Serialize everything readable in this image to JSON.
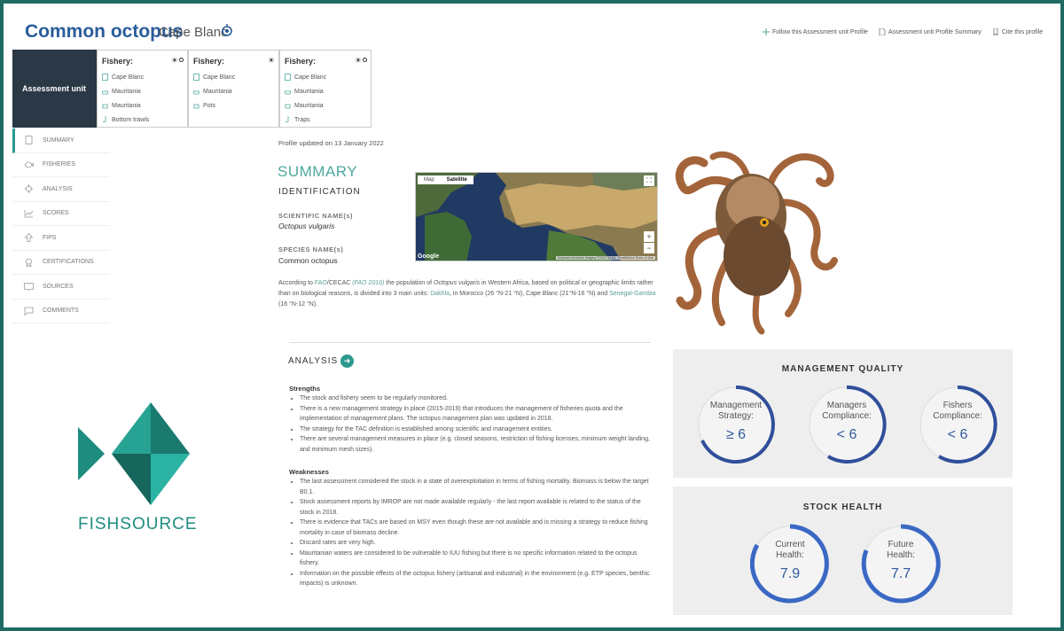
{
  "header": {
    "title": "Common octopus",
    "subtitle": "Cape Blanc",
    "actions": [
      {
        "label": "Follow this Assessment unit Profile",
        "icon": "plus-icon"
      },
      {
        "label": "Assessment unit Profile Summary",
        "icon": "document-icon"
      },
      {
        "label": "Cite this profile",
        "icon": "bookmark-icon"
      }
    ]
  },
  "assessment_unit": {
    "label": "Assessment unit"
  },
  "fisheries": [
    {
      "heading": "Fishery:",
      "items": [
        "Cape Blanc",
        "Mauritania",
        "Mauritania",
        "Bottom trawls"
      ]
    },
    {
      "heading": "Fishery:",
      "items": [
        "Cape Blanc",
        "Mauritania",
        "Pots"
      ]
    },
    {
      "heading": "Fishery:",
      "items": [
        "Cape Blanc",
        "Mauritania",
        "Mauritania",
        "Traps"
      ]
    }
  ],
  "sidenav": [
    "SUMMARY",
    "FISHERIES",
    "ANALYSIS",
    "SCORES",
    "FIPS",
    "CERTIFICATIONS",
    "SOURCES",
    "COMMENTS"
  ],
  "summary": {
    "updated": "Profile updated on 13 January 2022",
    "heading": "SUMMARY",
    "identification": "IDENTIFICATION",
    "sci_label": "SCIENTIFIC NAME(s)",
    "sci_value": "Octopus vulgaris",
    "species_label": "SPECIES NAME(s)",
    "species_value": "Common octopus",
    "intro": {
      "t1": "According to ",
      "l1": "FAO",
      "t2": "/CECAC ",
      "l2": "(FAO 2016)",
      "t3": " the population of ",
      "t4": "Octopus vulgaris",
      "t5": " in Western Africa, based on political or geographic limits rather than on biological reasons, is divided into 3 main units: ",
      "l3": "Dakhla",
      "t6": ", in Morocco (26 °N-21 °N), Cape Blanc (21°N-16 °N) and ",
      "l4": "Senegal-Gambia",
      "t7": " (16 °N-12 °N)."
    }
  },
  "map": {
    "tab_map": "Map",
    "tab_satellite": "Satellite",
    "google": "Google",
    "attribution": "Keyboard shortcuts  Imagery ©2022 NASA, TerraMetrics  Terms of Use",
    "zoom_in": "+",
    "zoom_out": "−"
  },
  "analysis": {
    "heading": "ANALYSIS",
    "strengths_h": "Strengths",
    "strengths": [
      "The stock and fishery seem to be regularly monitored.",
      "There is a new management strategy in place (2015-2019) that introduces the management of fisheries quota and the implementation of management plans. The octopus management plan was updated in 2018.",
      "The strategy for the TAC definition is established among scientific and management entities.",
      "There are several management measures in place (e.g. closed seasons, restriction of fishing licenses, minimum weight landing, and minimum mesh sizes)."
    ],
    "weaknesses_h": "Weaknesses",
    "weaknesses": [
      "The last assessment considered the stock in a state of overexploitation in terms of fishing mortality. Biomass is below the target B0.1.",
      "Stock assessment reports by IMROP are not made available regularly - the last report available is related to the status of the stock in 2018.",
      "There is evidence that TACs are based on MSY even though these are not available and is missing a strategy to reduce fishing mortality in case of biomass decline.",
      "Discard rates are very high.",
      "Mauritanian waters are considered to be vulnerable to IUU fishing but there is no specific information related to the octopus fishery.",
      "Information on the possible effects of the octopus fishery (artisanal and industrial) in the environment (e.g. ETP species, benthic impacts) is unknown."
    ]
  },
  "management_quality": {
    "title": "MANAGEMENT QUALITY",
    "gauges": [
      {
        "l1": "Management",
        "l2": "Strategy:",
        "value": "≥ 6"
      },
      {
        "l1": "Managers",
        "l2": "Compliance:",
        "value": "< 6"
      },
      {
        "l1": "Fishers",
        "l2": "Compliance:",
        "value": "< 6"
      }
    ]
  },
  "stock_health": {
    "title": "STOCK HEALTH",
    "gauges": [
      {
        "l1": "Current",
        "l2": "Health:",
        "value": "7.9"
      },
      {
        "l1": "Future",
        "l2": "Health:",
        "value": "7.7"
      }
    ]
  },
  "logo": {
    "text": "FISHSOURCE"
  },
  "colors": {
    "accent": "#2b9a8d",
    "title_blue": "#2a5d9a",
    "gauge_blue": "#2f5b9e",
    "border": "#1f6b63",
    "dark": "#2b3845"
  }
}
